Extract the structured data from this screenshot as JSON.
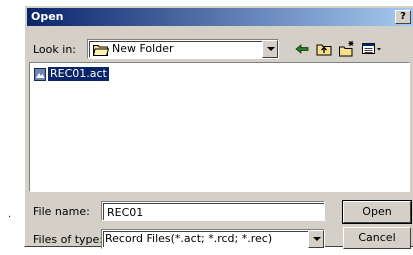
{
  "dialog": {
    "title": "Open",
    "help_label": "?"
  },
  "look_in": {
    "label": "Look in:",
    "folder": "New Folder"
  },
  "toolbar": {
    "icons": [
      "back-arrow-icon",
      "up-folder-icon",
      "new-folder-icon",
      "view-menu-icon"
    ]
  },
  "files": [
    {
      "name": "REC01.act",
      "selected": true
    }
  ],
  "file_name": {
    "label": "File name:",
    "value": "REC01"
  },
  "file_type": {
    "label": "Files of type:",
    "value": "Record Files(*.act; *.rcd; *.rec)"
  },
  "buttons": {
    "open": "Open",
    "cancel": "Cancel"
  },
  "colors": {
    "title_start": "#0a246a",
    "title_end": "#a6caf0",
    "face": "#d4d0c8",
    "selection": "#0a246a"
  }
}
